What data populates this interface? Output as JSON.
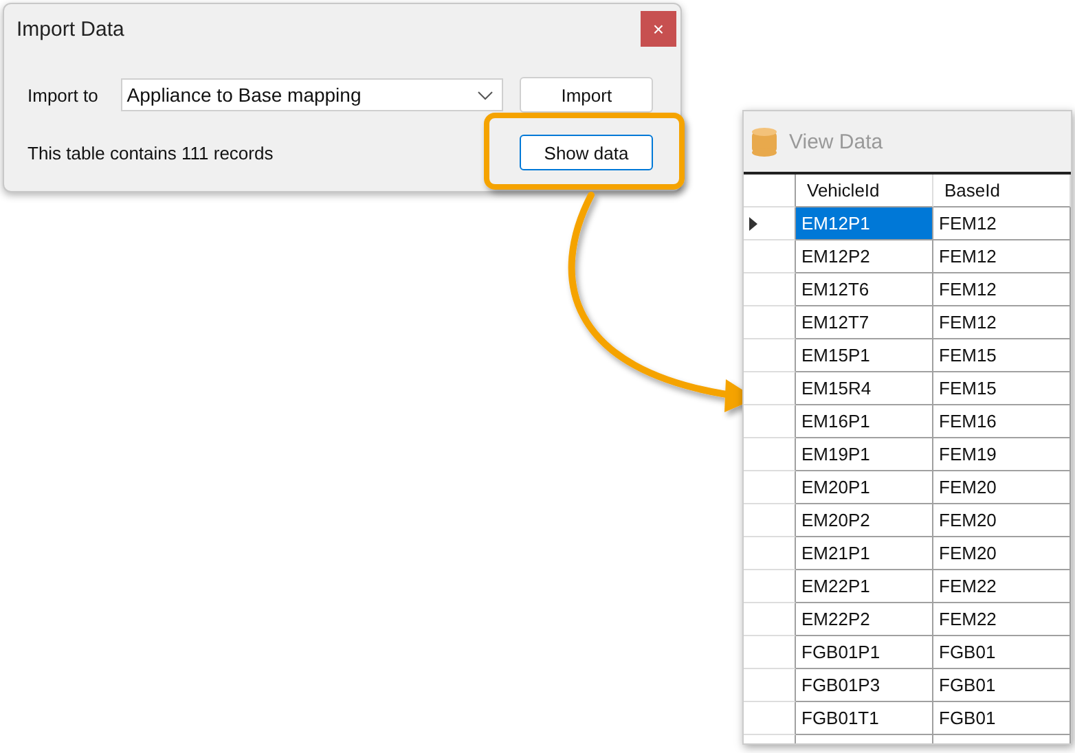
{
  "dialog": {
    "title": "Import Data",
    "close": "×",
    "import_label": "Import to",
    "target": "Appliance to Base mapping",
    "import_button": "Import",
    "record_info": "This table contains 111 records",
    "show_button": "Show data"
  },
  "view_window": {
    "title": "View Data",
    "columns": [
      "VehicleId",
      "BaseId"
    ],
    "rows": [
      {
        "cells": [
          "EM12P1",
          "FEM12"
        ],
        "selected": true
      },
      {
        "cells": [
          "EM12P2",
          "FEM12"
        ],
        "selected": false
      },
      {
        "cells": [
          "EM12T6",
          "FEM12"
        ],
        "selected": false
      },
      {
        "cells": [
          "EM12T7",
          "FEM12"
        ],
        "selected": false
      },
      {
        "cells": [
          "EM15P1",
          "FEM15"
        ],
        "selected": false
      },
      {
        "cells": [
          "EM15R4",
          "FEM15"
        ],
        "selected": false
      },
      {
        "cells": [
          "EM16P1",
          "FEM16"
        ],
        "selected": false
      },
      {
        "cells": [
          "EM19P1",
          "FEM19"
        ],
        "selected": false
      },
      {
        "cells": [
          "EM20P1",
          "FEM20"
        ],
        "selected": false
      },
      {
        "cells": [
          "EM20P2",
          "FEM20"
        ],
        "selected": false
      },
      {
        "cells": [
          "EM21P1",
          "FEM20"
        ],
        "selected": false
      },
      {
        "cells": [
          "EM22P1",
          "FEM22"
        ],
        "selected": false
      },
      {
        "cells": [
          "EM22P2",
          "FEM22"
        ],
        "selected": false
      },
      {
        "cells": [
          "FGB01P1",
          "FGB01"
        ],
        "selected": false
      },
      {
        "cells": [
          "FGB01P3",
          "FGB01"
        ],
        "selected": false
      },
      {
        "cells": [
          "FGB01T1",
          "FGB01"
        ],
        "selected": false
      }
    ]
  }
}
